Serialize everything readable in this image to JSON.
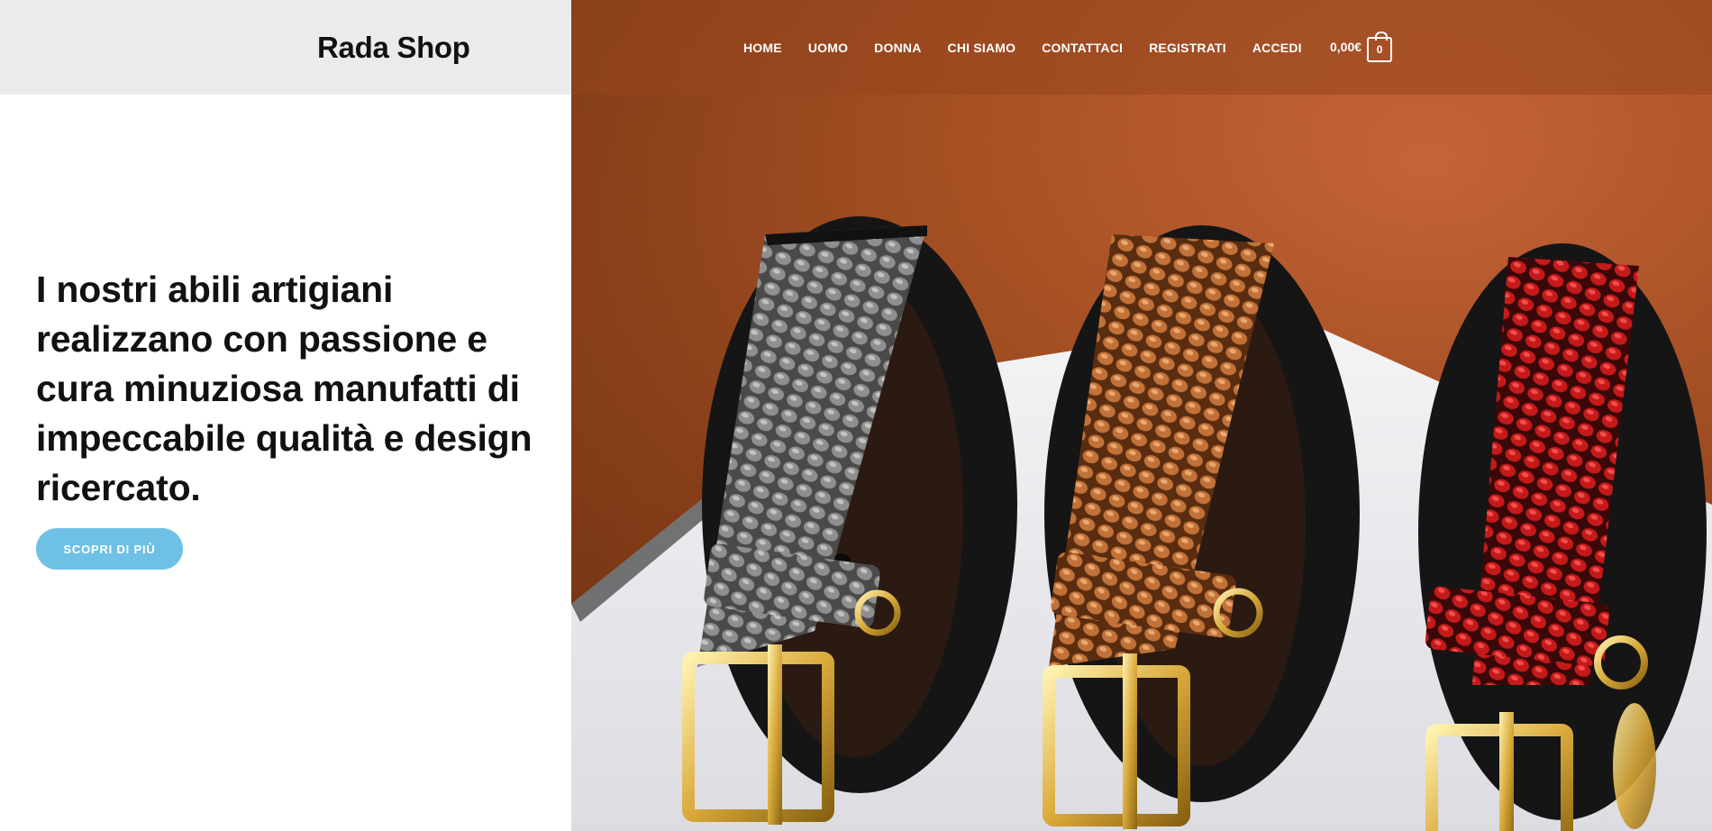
{
  "brand": {
    "name": "Rada Shop"
  },
  "nav": {
    "items": [
      "HOME",
      "UOMO",
      "DONNA",
      "CHI SIAMO",
      "CONTATTACI",
      "REGISTRATI",
      "ACCEDI"
    ]
  },
  "cart": {
    "total": "0,00€",
    "count": "0",
    "icon": "shopping-bag-icon"
  },
  "hero": {
    "headline": "I nostri abili artigiani realizzano con passione e cura minuziosa manufatti di impeccabile qualità e design ricercato.",
    "cta_label": "SCOPRI DI PIÙ",
    "image_subject": "three leather belts with snake-skin texture (grey, copper, red) and gold buckles"
  },
  "colors": {
    "accent": "#6ec1e4",
    "brand_bar": "#ebebeb",
    "hero_bg": "#a44f22",
    "belt_grey": "#6b6b6b",
    "belt_copper": "#b5672e",
    "belt_red": "#c01818",
    "buckle_gold": "#e2b84a"
  }
}
